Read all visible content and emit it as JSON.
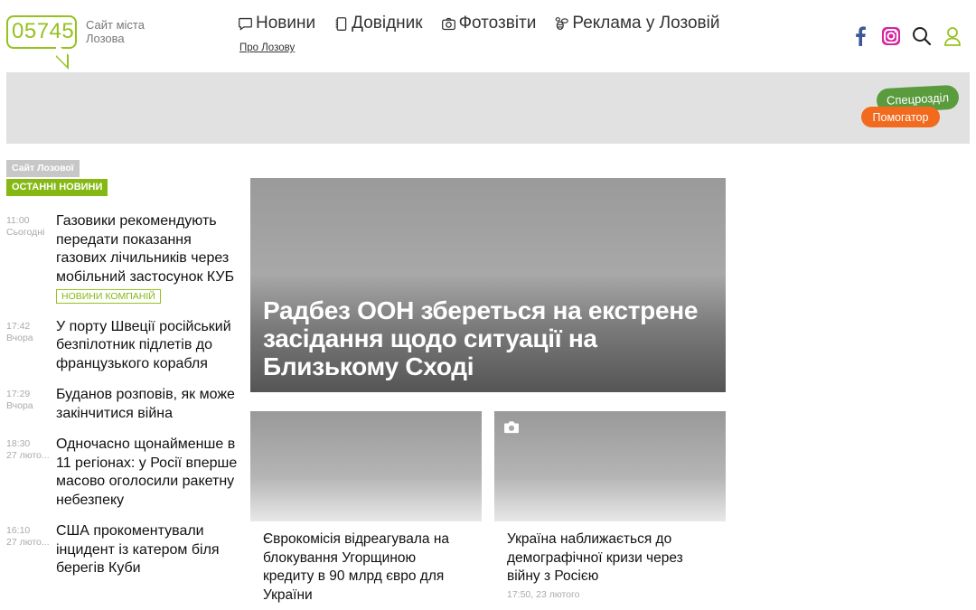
{
  "logo": {
    "number": "05745",
    "tagline": "Сайт міста Лозова"
  },
  "nav": {
    "items": [
      {
        "label": "Новини",
        "icon": "chat-bubble-icon"
      },
      {
        "label": "Довідник",
        "icon": "notebook-icon"
      },
      {
        "label": "Фотозвіти",
        "icon": "camera-icon"
      },
      {
        "label": "Реклама у Лозовій",
        "icon": "bee-icon"
      }
    ],
    "sub_link": "Про Лозову"
  },
  "header_icons": [
    "facebook-icon",
    "instagram-icon",
    "search-icon",
    "user-icon"
  ],
  "banner": {
    "special_label": "Спецрозділ",
    "helper_label": "Помогатор"
  },
  "sidebar": {
    "site_tag": "Сайт Лозової",
    "latest_tag": "Останні новини",
    "news": [
      {
        "time": "11:00",
        "day": "Сьогодні",
        "title": "Газовики рекомендують передати показання газових лічильників через мобільний застосунок КУБ",
        "badge": "Новини компаній"
      },
      {
        "time": "17:42",
        "day": "Вчора",
        "title": "У порту Швеції російський безпілотник підлетів до французького корабля"
      },
      {
        "time": "17:29",
        "day": "Вчора",
        "title": "Буданов розповів, як може закінчитися війна"
      },
      {
        "time": "18:30",
        "day": "27 люто...",
        "title": "Одночасно щонайменше в 11 регіонах: у Росії вперше масово оголосили ракетну небезпеку"
      },
      {
        "time": "16:10",
        "day": "27 люто...",
        "title": "США прокоментували інцидент із катером біля берегів Куби"
      }
    ]
  },
  "main": {
    "hero_title": "Радбез ООН збереться на екстрене засідання щодо ситуації на Близькому Сході",
    "cards": [
      {
        "title": "Єврокомісія відреагувала на блокування Угорщиною кредиту в 90 млрд євро для України",
        "date": ""
      },
      {
        "title": "Україна наближається до демографічної кризи через війну з Росією",
        "date": "17:50, 23 лютого",
        "icon": "camera-icon"
      }
    ]
  },
  "colors": {
    "brand_green": "#96c11f",
    "special_green": "#5a9b3d",
    "helper_orange": "#f26a1e",
    "banner_gray": "#e1e1e1"
  }
}
